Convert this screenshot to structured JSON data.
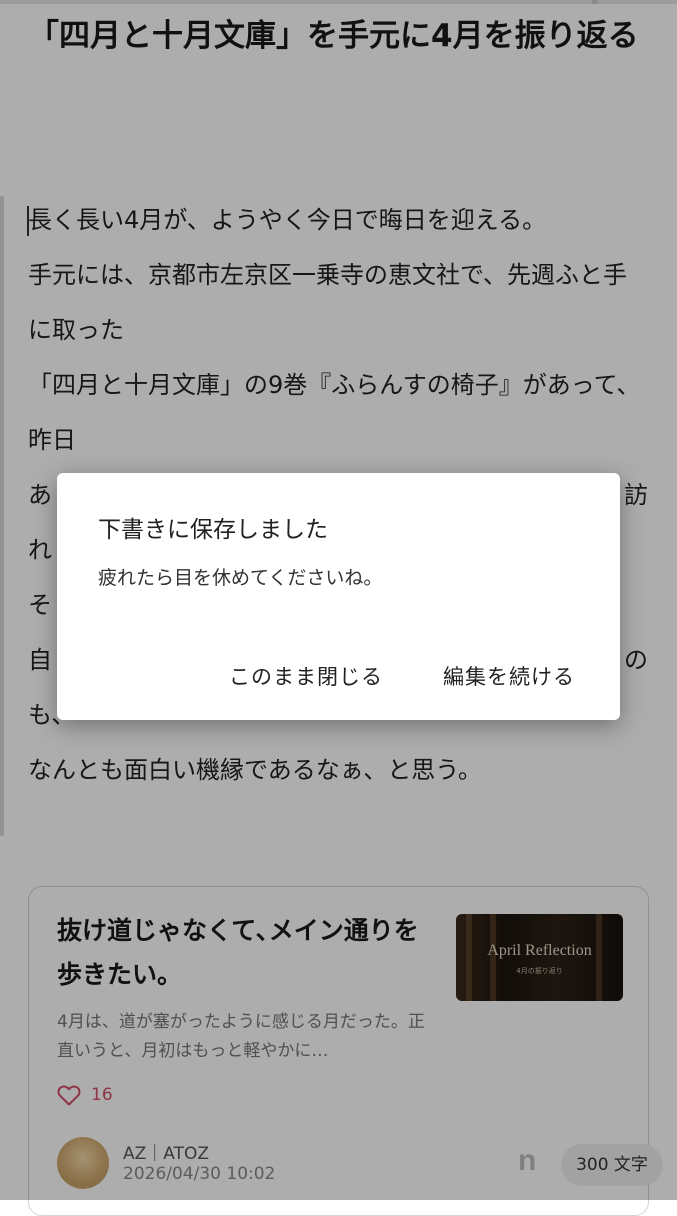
{
  "article": {
    "title": "「四月と十月文庫」を手元に4月を振り返る",
    "body": [
      "長く長い4月が、ようやく今日で晦日を迎える。",
      "手元には、京都市左京区一乗寺の恵文社で、先週ふと手に取った",
      "「四月と十月文庫」の9巻『ふらんすの椅子』があって、",
      "昨日",
      "あ",
      "訪",
      "れ",
      "そ",
      "自",
      "の",
      "も、",
      "なんとも面白い機縁であるなぁ、と思う。"
    ]
  },
  "card": {
    "title": "抜け道じゃなくて､メイン通りを歩きたい。",
    "thumbnail_title": "April Reflection",
    "thumbnail_subtitle": "4月の振り返り",
    "excerpt": "4月は、道が塞がったように感じる月だった。正直いうと、月初はもっと軽やかに…",
    "likes": "16",
    "author": "AZ｜ATOZ",
    "date": "2026/04/30 10:02",
    "heart_icon": "heart-outline-icon",
    "heart_color": "#d14b66"
  },
  "footer": {
    "logo": "n",
    "char_count": "300 文字"
  },
  "dialog": {
    "title": "下書きに保存しました",
    "message": "疲れたら目を休めてくださいね。",
    "close_label": "このまま閉じる",
    "continue_label": "編集を続ける"
  }
}
